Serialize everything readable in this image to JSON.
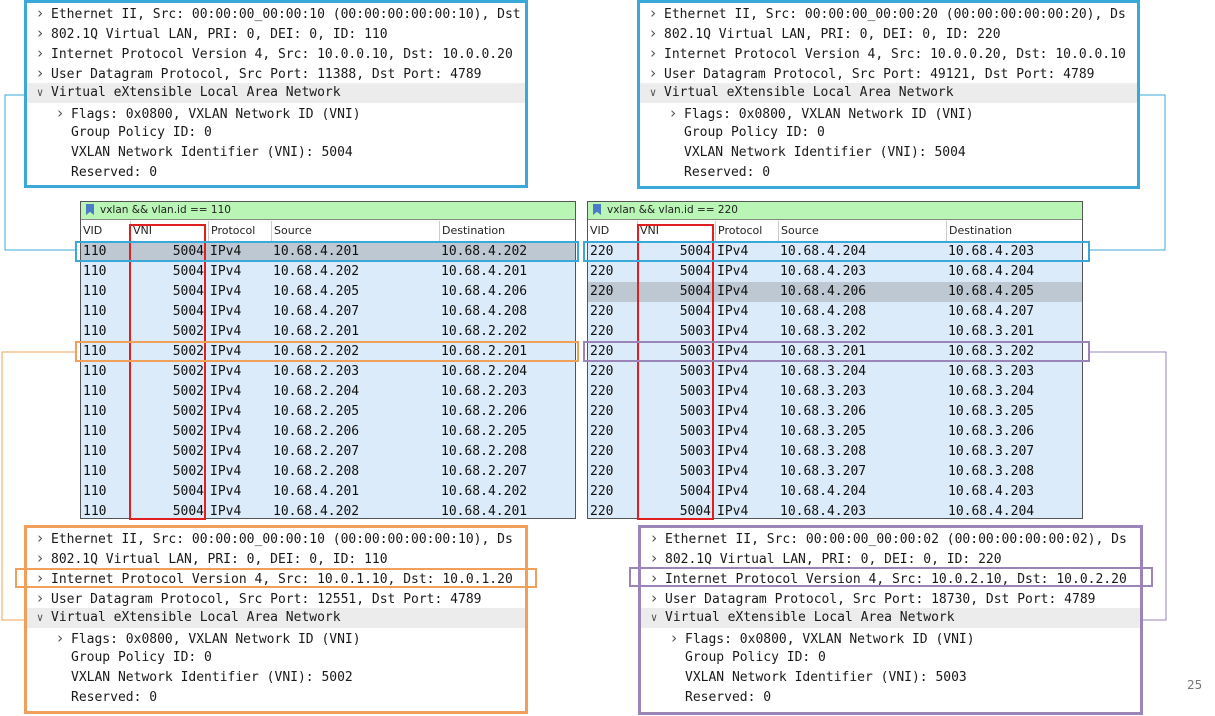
{
  "colors": {
    "blue": "#3aa9d9",
    "orange": "#f0a05a",
    "purple": "#9b85b8",
    "red": "#e02020",
    "row_bg": "#dcebf9",
    "filter_bg": "#b9f5b4"
  },
  "icons": {
    "expand": "chevron-right-icon",
    "collapse": "chevron-down-icon",
    "filter": "bookmark-icon"
  },
  "details": {
    "top_left": [
      {
        "arrow": ">",
        "indent": 0,
        "text": "Ethernet II, Src: 00:00:00_00:00:10 (00:00:00:00:00:10), Dst"
      },
      {
        "arrow": ">",
        "indent": 0,
        "text": "802.1Q Virtual LAN, PRI: 0, DEI: 0, ID: 110"
      },
      {
        "arrow": ">",
        "indent": 0,
        "text": "Internet Protocol Version 4, Src: 10.0.0.10, Dst: 10.0.0.20"
      },
      {
        "arrow": ">",
        "indent": 0,
        "text": "User Datagram Protocol, Src Port: 11388, Dst Port: 4789"
      },
      {
        "arrow": "v",
        "indent": 0,
        "text": "Virtual eXtensible Local Area Network",
        "hl": true
      },
      {
        "arrow": ">",
        "indent": 1,
        "text": "Flags: 0x0800, VXLAN Network ID (VNI)"
      },
      {
        "arrow": "",
        "indent": 1,
        "text": "Group Policy ID: 0"
      },
      {
        "arrow": "",
        "indent": 1,
        "text": "VXLAN Network Identifier (VNI): 5004"
      },
      {
        "arrow": "",
        "indent": 1,
        "text": "Reserved: 0"
      }
    ],
    "top_right": [
      {
        "arrow": ">",
        "indent": 0,
        "text": "Ethernet II, Src: 00:00:00_00:00:20 (00:00:00:00:00:20), Ds"
      },
      {
        "arrow": ">",
        "indent": 0,
        "text": "802.1Q Virtual LAN, PRI: 0, DEI: 0, ID: 220"
      },
      {
        "arrow": ">",
        "indent": 0,
        "text": "Internet Protocol Version 4, Src: 10.0.0.20, Dst: 10.0.0.10"
      },
      {
        "arrow": ">",
        "indent": 0,
        "text": "User Datagram Protocol, Src Port: 49121, Dst Port: 4789"
      },
      {
        "arrow": "v",
        "indent": 0,
        "text": "Virtual eXtensible Local Area Network",
        "hl": true
      },
      {
        "arrow": ">",
        "indent": 1,
        "text": "Flags: 0x0800, VXLAN Network ID (VNI)"
      },
      {
        "arrow": "",
        "indent": 1,
        "text": "Group Policy ID: 0"
      },
      {
        "arrow": "",
        "indent": 1,
        "text": "VXLAN Network Identifier (VNI): 5004"
      },
      {
        "arrow": "",
        "indent": 1,
        "text": "Reserved: 0"
      }
    ],
    "bottom_left": [
      {
        "arrow": ">",
        "indent": 0,
        "text": "Ethernet II, Src: 00:00:00_00:00:10 (00:00:00:00:00:10), Ds"
      },
      {
        "arrow": ">",
        "indent": 0,
        "text": "802.1Q Virtual LAN, PRI: 0, DEI: 0, ID: 110"
      },
      {
        "arrow": ">",
        "indent": 0,
        "text": "Internet Protocol Version 4, Src: 10.0.1.10, Dst: 10.0.1.20"
      },
      {
        "arrow": ">",
        "indent": 0,
        "text": "User Datagram Protocol, Src Port: 12551, Dst Port: 4789"
      },
      {
        "arrow": "v",
        "indent": 0,
        "text": "Virtual eXtensible Local Area Network",
        "hl": true
      },
      {
        "arrow": ">",
        "indent": 1,
        "text": "Flags: 0x0800, VXLAN Network ID (VNI)"
      },
      {
        "arrow": "",
        "indent": 1,
        "text": "Group Policy ID: 0"
      },
      {
        "arrow": "",
        "indent": 1,
        "text": "VXLAN Network Identifier (VNI): 5002"
      },
      {
        "arrow": "",
        "indent": 1,
        "text": "Reserved: 0"
      }
    ],
    "bottom_right": [
      {
        "arrow": ">",
        "indent": 0,
        "text": "Ethernet II, Src: 00:00:00_00:00:02 (00:00:00:00:00:02), Ds"
      },
      {
        "arrow": ">",
        "indent": 0,
        "text": "802.1Q Virtual LAN, PRI: 0, DEI: 0, ID: 220"
      },
      {
        "arrow": ">",
        "indent": 0,
        "text": "Internet Protocol Version 4, Src: 10.0.2.10, Dst: 10.0.2.20"
      },
      {
        "arrow": ">",
        "indent": 0,
        "text": "User Datagram Protocol, Src Port: 18730, Dst Port: 4789"
      },
      {
        "arrow": "v",
        "indent": 0,
        "text": "Virtual eXtensible Local Area Network",
        "hl": true
      },
      {
        "arrow": ">",
        "indent": 1,
        "text": "Flags: 0x0800, VXLAN Network ID (VNI)"
      },
      {
        "arrow": "",
        "indent": 1,
        "text": "Group Policy ID: 0"
      },
      {
        "arrow": "",
        "indent": 1,
        "text": "VXLAN Network Identifier (VNI): 5003"
      },
      {
        "arrow": "",
        "indent": 1,
        "text": "Reserved: 0"
      }
    ]
  },
  "lists": {
    "left": {
      "filter": "vxlan && vlan.id == 110",
      "columns": [
        "VID",
        "VNI",
        "Protocol",
        "Source",
        "Destination"
      ],
      "rows": [
        [
          "110",
          "5004",
          "IPv4",
          "10.68.4.201",
          "10.68.4.202"
        ],
        [
          "110",
          "5004",
          "IPv4",
          "10.68.4.202",
          "10.68.4.201"
        ],
        [
          "110",
          "5004",
          "IPv4",
          "10.68.4.205",
          "10.68.4.206"
        ],
        [
          "110",
          "5004",
          "IPv4",
          "10.68.4.207",
          "10.68.4.208"
        ],
        [
          "110",
          "5002",
          "IPv4",
          "10.68.2.201",
          "10.68.2.202"
        ],
        [
          "110",
          "5002",
          "IPv4",
          "10.68.2.202",
          "10.68.2.201"
        ],
        [
          "110",
          "5002",
          "IPv4",
          "10.68.2.203",
          "10.68.2.204"
        ],
        [
          "110",
          "5002",
          "IPv4",
          "10.68.2.204",
          "10.68.2.203"
        ],
        [
          "110",
          "5002",
          "IPv4",
          "10.68.2.205",
          "10.68.2.206"
        ],
        [
          "110",
          "5002",
          "IPv4",
          "10.68.2.206",
          "10.68.2.205"
        ],
        [
          "110",
          "5002",
          "IPv4",
          "10.68.2.207",
          "10.68.2.208"
        ],
        [
          "110",
          "5002",
          "IPv4",
          "10.68.2.208",
          "10.68.2.207"
        ],
        [
          "110",
          "5004",
          "IPv4",
          "10.68.4.201",
          "10.68.4.202"
        ],
        [
          "110",
          "5004",
          "IPv4",
          "10.68.4.202",
          "10.68.4.201"
        ]
      ],
      "selected_row": 0
    },
    "right": {
      "filter": "vxlan && vlan.id == 220",
      "columns": [
        "VID",
        "VNI",
        "Protocol",
        "Source",
        "Destination"
      ],
      "rows": [
        [
          "220",
          "5004",
          "IPv4",
          "10.68.4.204",
          "10.68.4.203"
        ],
        [
          "220",
          "5004",
          "IPv4",
          "10.68.4.203",
          "10.68.4.204"
        ],
        [
          "220",
          "5004",
          "IPv4",
          "10.68.4.206",
          "10.68.4.205"
        ],
        [
          "220",
          "5004",
          "IPv4",
          "10.68.4.208",
          "10.68.4.207"
        ],
        [
          "220",
          "5003",
          "IPv4",
          "10.68.3.202",
          "10.68.3.201"
        ],
        [
          "220",
          "5003",
          "IPv4",
          "10.68.3.201",
          "10.68.3.202"
        ],
        [
          "220",
          "5003",
          "IPv4",
          "10.68.3.204",
          "10.68.3.203"
        ],
        [
          "220",
          "5003",
          "IPv4",
          "10.68.3.203",
          "10.68.3.204"
        ],
        [
          "220",
          "5003",
          "IPv4",
          "10.68.3.206",
          "10.68.3.205"
        ],
        [
          "220",
          "5003",
          "IPv4",
          "10.68.3.205",
          "10.68.3.206"
        ],
        [
          "220",
          "5003",
          "IPv4",
          "10.68.3.208",
          "10.68.3.207"
        ],
        [
          "220",
          "5003",
          "IPv4",
          "10.68.3.207",
          "10.68.3.208"
        ],
        [
          "220",
          "5004",
          "IPv4",
          "10.68.4.204",
          "10.68.4.203"
        ],
        [
          "220",
          "5004",
          "IPv4",
          "10.68.4.203",
          "10.68.4.204"
        ]
      ],
      "selected_row": 2
    }
  },
  "page_number": "25"
}
